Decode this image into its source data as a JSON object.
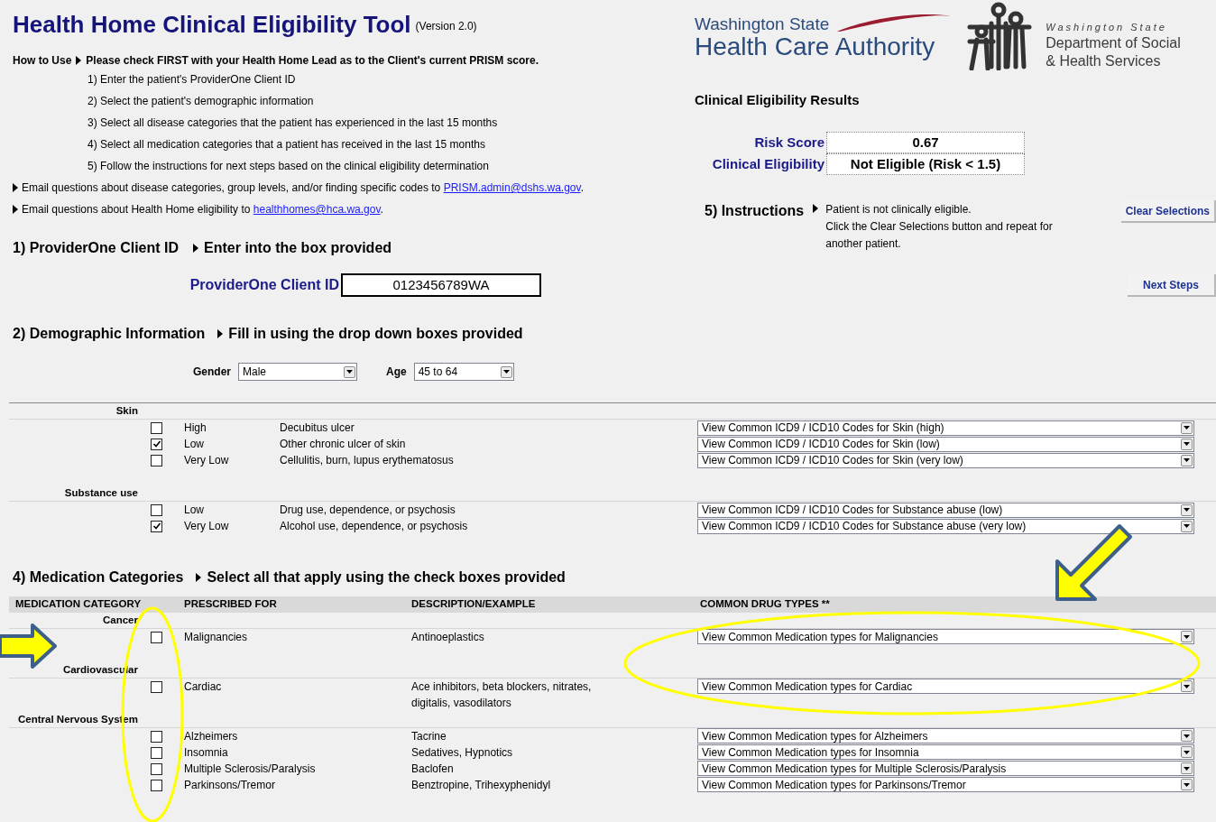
{
  "title": "Health Home Clinical Eligibility Tool",
  "version": "(Version 2.0)",
  "how_to_use": {
    "label": "How to Use",
    "intro": "Please check FIRST with your Health Home Lead as to the Client's current PRISM score.",
    "steps": [
      "1) Enter the patient's ProviderOne Client ID",
      "2) Select the patient's demographic information",
      "3) Select all disease categories that the patient has experienced in the last 15 months",
      "4) Select all medication categories that a patient has received in the last 15 months",
      "5) Follow the instructions for next steps based on the clinical eligibility determination"
    ]
  },
  "emails": [
    {
      "text": "Email questions about disease categories, group levels, and/or finding specific codes  to",
      "link": "PRISM.admin@dshs.wa.gov",
      "after": "."
    },
    {
      "text": "Email questions about Health Home eligibility to",
      "link": "healthhomes@hca.wa.gov",
      "after": "."
    }
  ],
  "logos": {
    "hca": [
      "Washington State",
      "Health Care Authority"
    ],
    "dshs": [
      "Washington State",
      "Department of Social",
      "& Health Services"
    ]
  },
  "results": {
    "title": "Clinical Eligibility Results",
    "rows": [
      {
        "label": "Risk Score",
        "value": "0.67"
      },
      {
        "label": "Clinical Eligibility",
        "value": "Not Eligible (Risk < 1.5)"
      }
    ]
  },
  "instructions": {
    "label": "5) Instructions",
    "text": [
      "Patient is not clinically eligible.",
      "Click the Clear Selections button and repeat for another patient."
    ]
  },
  "buttons": [
    "Clear Selections",
    "Next Steps"
  ],
  "client_id": {
    "title": "1) ProviderOne Client ID",
    "hint": "Enter into the box provided",
    "label": "ProviderOne Client ID",
    "value": "0123456789WA"
  },
  "demographics": {
    "title": "2) Demographic Information",
    "hint": "Fill in using the drop down boxes provided",
    "fields": [
      {
        "label": "Gender",
        "value": "Male"
      },
      {
        "label": "Age",
        "value": "45 to 64"
      }
    ]
  },
  "disease_groups": [
    {
      "name": "Skin",
      "items": [
        {
          "severity": "High",
          "description": "Decubitus ulcer",
          "dropdown": "View Common ICD9 / ICD10 Codes for Skin (high)",
          "checked": false
        },
        {
          "severity": "Low",
          "description": "Other chronic ulcer of skin",
          "dropdown": "View Common ICD9 / ICD10 Codes for Skin (low)",
          "checked": true
        },
        {
          "severity": "Very Low",
          "description": "Cellulitis, burn, lupus erythematosus",
          "dropdown": "View Common ICD9 / ICD10 Codes for Skin (very low)",
          "checked": false
        }
      ]
    },
    {
      "name": "Substance use",
      "items": [
        {
          "severity": "Low",
          "description": "Drug use, dependence, or psychosis",
          "dropdown": "View Common ICD9 / ICD10 Codes for Substance abuse (low)",
          "checked": false
        },
        {
          "severity": "Very Low",
          "description": "Alcohol use, dependence, or psychosis",
          "dropdown": "View Common ICD9 / ICD10 Codes for Substance abuse (very low)",
          "checked": true
        }
      ]
    }
  ],
  "medications": {
    "title": "4) Medication Categories",
    "hint": "Select all that apply using the check boxes provided",
    "columns": [
      "MEDICATION CATEGORY",
      "PRESCRIBED FOR",
      "DESCRIPTION/EXAMPLE",
      "COMMON DRUG TYPES **"
    ],
    "groups": [
      {
        "name": "Cancer",
        "items": [
          {
            "prescribed_for": "Malignancies",
            "description": "Antinoeplastics",
            "dropdown": "View Common Medication types for Malignancies",
            "checked": false
          }
        ]
      },
      {
        "name": "Cardiovascular",
        "items": [
          {
            "prescribed_for": "Cardiac",
            "description": "Ace inhibitors, beta blockers, nitrates, digitalis, vasodilators",
            "dropdown": "View Common Medication types for Cardiac",
            "checked": false
          }
        ]
      },
      {
        "name": "Central Nervous System",
        "items": [
          {
            "prescribed_for": "Alzheimers",
            "description": "Tacrine",
            "dropdown": "View Common Medication types for Alzheimers",
            "checked": false
          },
          {
            "prescribed_for": "Insomnia",
            "description": "Sedatives, Hypnotics",
            "dropdown": "View Common Medication types for Insomnia",
            "checked": false
          },
          {
            "prescribed_for": "Multiple Sclerosis/Paralysis",
            "description": "Baclofen",
            "dropdown": "View Common Medication types for Multiple Sclerosis/Paralysis",
            "checked": false
          },
          {
            "prescribed_for": "Parkinsons/Tremor",
            "description": "Benztropine, Trihexyphenidyl",
            "dropdown": "View Common Medication types for Parkinsons/Tremor",
            "checked": false
          }
        ]
      }
    ]
  }
}
